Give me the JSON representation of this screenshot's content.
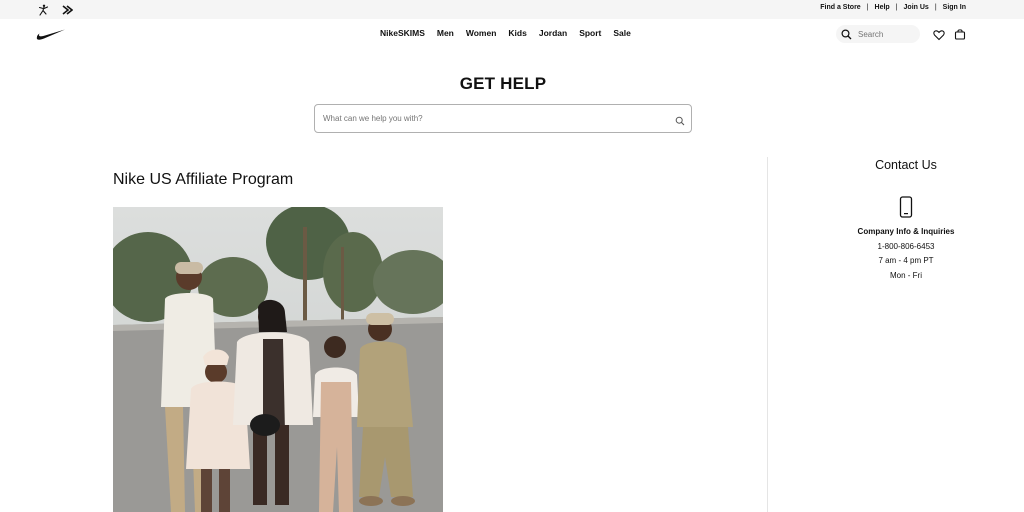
{
  "utility_bar": {
    "links": [
      "Find a Store",
      "Help",
      "Join Us",
      "Sign In"
    ]
  },
  "nav": {
    "menu": [
      "NikeSKIMS",
      "Men",
      "Women",
      "Kids",
      "Jordan",
      "Sport",
      "Sale"
    ],
    "search_placeholder": "Search"
  },
  "help": {
    "title": "GET HELP",
    "search_placeholder": "What can we help you with?"
  },
  "article": {
    "title": "Nike US Affiliate Program"
  },
  "contact": {
    "title": "Contact Us",
    "label": "Company Info & Inquiries",
    "phone": "1-800-806-6453",
    "hours": "7 am - 4 pm PT",
    "days": "Mon - Fri"
  },
  "colors": {
    "utility_bg": "#f5f5f5",
    "text": "#111111",
    "divider": "#e5e5e5"
  },
  "icons": [
    "jordan-icon",
    "converse-icon",
    "nike-swoosh-icon",
    "search-icon",
    "heart-icon",
    "bag-icon",
    "phone-icon"
  ]
}
